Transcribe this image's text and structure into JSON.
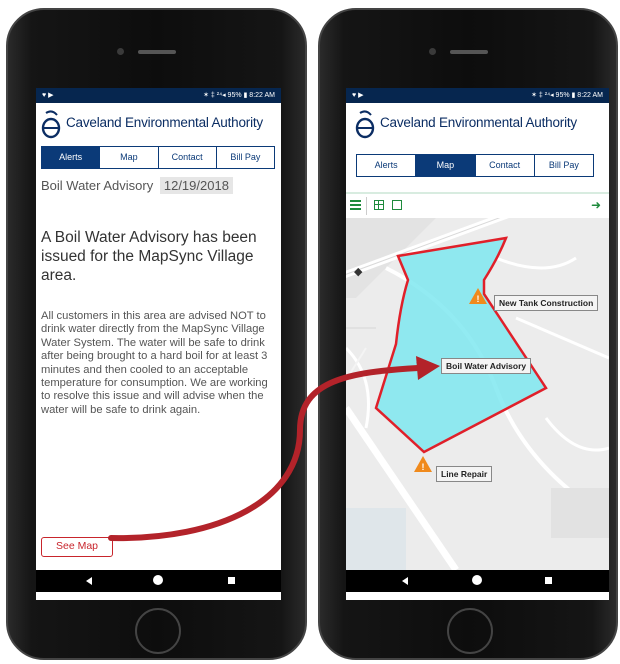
{
  "status": {
    "left": "♥ ▶",
    "right": "✶ ‡ ²⁴◂ 95% ▮ 8:22 AM"
  },
  "app": {
    "title": "Caveland Environmental Authority"
  },
  "tabs": [
    "Alerts",
    "Map",
    "Contact",
    "Bill Pay"
  ],
  "advisory": {
    "title": "Boil Water Advisory",
    "date": "12/19/2018",
    "headline": "A Boil Water Advisory has been issued for the MapSync Village area.",
    "body": "All customers in this area are advised NOT to drink water directly from the MapSync Village Water System. The water will be safe to drink after being brought to a hard boil for at least 3 minutes and then cooled to an acceptable temperature for consumption. We are working to resolve this issue and will advise when the water will be safe to drink again.",
    "see_map": "See Map"
  },
  "map": {
    "labels": {
      "new_tank": "New Tank Construction",
      "boil": "Boil Water Advisory",
      "line_repair": "Line Repair"
    },
    "colors": {
      "advisory_fill": "#7fe8f0",
      "advisory_stroke": "#e0202a",
      "warning": "#f08a1c"
    }
  },
  "colors": {
    "brand": "#0b3a78",
    "status_bar": "#06264f",
    "accent_red": "#c8252c"
  }
}
